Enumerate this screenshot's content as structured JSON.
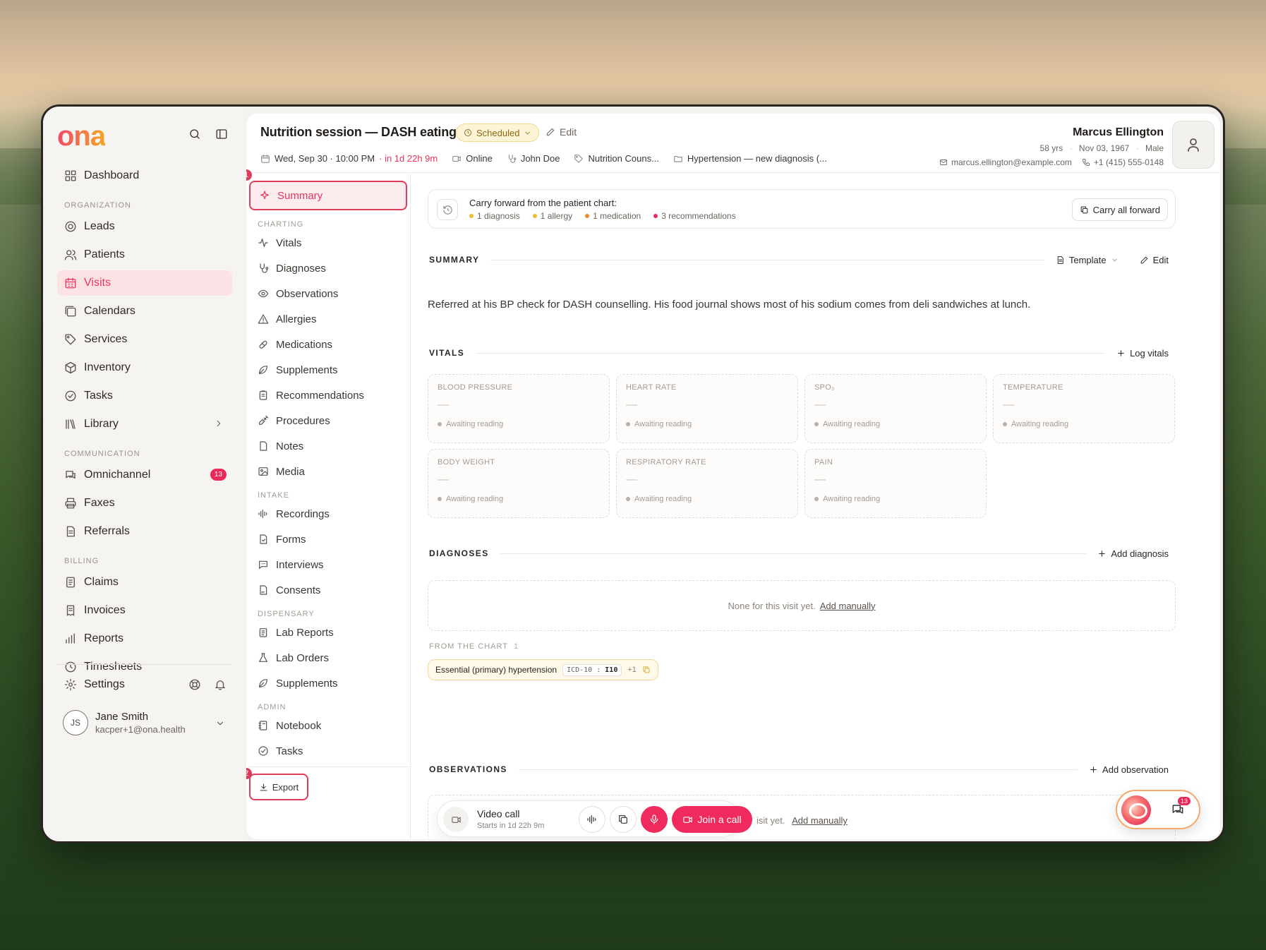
{
  "app": {
    "logo": "ona"
  },
  "sidebar": {
    "dashboard": "Dashboard",
    "sections": {
      "organization": "ORGANIZATION",
      "communication": "COMMUNICATION",
      "billing": "BILLING"
    },
    "organization_items": [
      "Leads",
      "Patients",
      "Visits",
      "Calendars",
      "Services",
      "Inventory",
      "Tasks",
      "Library"
    ],
    "communication_items": [
      "Omnichannel",
      "Faxes",
      "Referrals"
    ],
    "omnichannel_badge": "13",
    "billing_items": [
      "Claims",
      "Invoices",
      "Reports",
      "Timesheets"
    ],
    "settings": "Settings",
    "user": {
      "initials": "JS",
      "name": "Jane Smith",
      "email": "kacper+1@ona.health"
    }
  },
  "header": {
    "title": "Nutrition session — DASH eating plan",
    "status": "Scheduled",
    "edit": "Edit",
    "datetime": "Wed, Sep 30 · 10:00 PM",
    "relative": "· in 1d 22h 9m",
    "mode": "Online",
    "provider": "John Doe",
    "service": "Nutrition Couns...",
    "case": "Hypertension — new diagnosis (...",
    "patient": {
      "name": "Marcus Ellington",
      "age": "58 yrs",
      "dob": "Nov 03, 1967",
      "sex": "Male",
      "email": "marcus.ellington@example.com",
      "phone": "+1 (415) 555-0148"
    }
  },
  "chart_nav": {
    "summary": "Summary",
    "sections": {
      "charting": "CHARTING",
      "intake": "INTAKE",
      "dispensary": "DISPENSARY",
      "admin": "ADMIN"
    },
    "charting": [
      "Vitals",
      "Diagnoses",
      "Observations",
      "Allergies",
      "Medications",
      "Supplements",
      "Recommendations",
      "Procedures",
      "Notes",
      "Media"
    ],
    "intake": [
      "Recordings",
      "Forms",
      "Interviews",
      "Consents"
    ],
    "dispensary": [
      "Lab Reports",
      "Lab Orders",
      "Supplements"
    ],
    "admin": [
      "Notebook",
      "Tasks"
    ],
    "export": "Export",
    "steps": [
      "1",
      "2"
    ]
  },
  "carry": {
    "title": "Carry forward from the patient chart:",
    "stats": [
      {
        "count": "1",
        "label": "diagnosis",
        "color": "#f5b82e"
      },
      {
        "count": "1",
        "label": "allergy",
        "color": "#f5b82e"
      },
      {
        "count": "1",
        "label": "medication",
        "color": "#f08a24"
      },
      {
        "count": "3",
        "label": "recommendations",
        "color": "#ea2859"
      }
    ],
    "button": "Carry all forward"
  },
  "summary": {
    "title": "SUMMARY",
    "template": "Template",
    "edit": "Edit",
    "text": "Referred at his BP check for DASH counselling. His food journal shows most of his sodium comes from deli sandwiches at lunch."
  },
  "vitals": {
    "title": "VITALS",
    "action": "Log vitals",
    "cards": [
      {
        "label": "BLOOD PRESSURE",
        "value": "—",
        "status": "Awaiting reading"
      },
      {
        "label": "HEART RATE",
        "value": "—",
        "status": "Awaiting reading"
      },
      {
        "label": "SPO₂",
        "value": "—",
        "status": "Awaiting reading"
      },
      {
        "label": "TEMPERATURE",
        "value": "—",
        "status": "Awaiting reading"
      },
      {
        "label": "BODY WEIGHT",
        "value": "—",
        "status": "Awaiting reading"
      },
      {
        "label": "RESPIRATORY RATE",
        "value": "—",
        "status": "Awaiting reading"
      },
      {
        "label": "PAIN",
        "value": "—",
        "status": "Awaiting reading"
      }
    ]
  },
  "diagnoses": {
    "title": "DIAGNOSES",
    "action": "Add diagnosis",
    "empty": "None for this visit yet.",
    "add_manually": "Add manually",
    "from_chart": "FROM THE CHART",
    "from_chart_count": "1",
    "chip": {
      "name": "Essential (primary) hypertension",
      "code_system": "ICD-10 :",
      "code": "I10",
      "more": "+1"
    }
  },
  "observations": {
    "title": "OBSERVATIONS",
    "action": "Add observation",
    "empty_partial": "isit yet.",
    "add_manually": "Add manually"
  },
  "call": {
    "title": "Video call",
    "subtitle": "Starts in 1d 22h 9m",
    "join": "Join a call"
  },
  "assistant": {
    "badge": "13"
  }
}
